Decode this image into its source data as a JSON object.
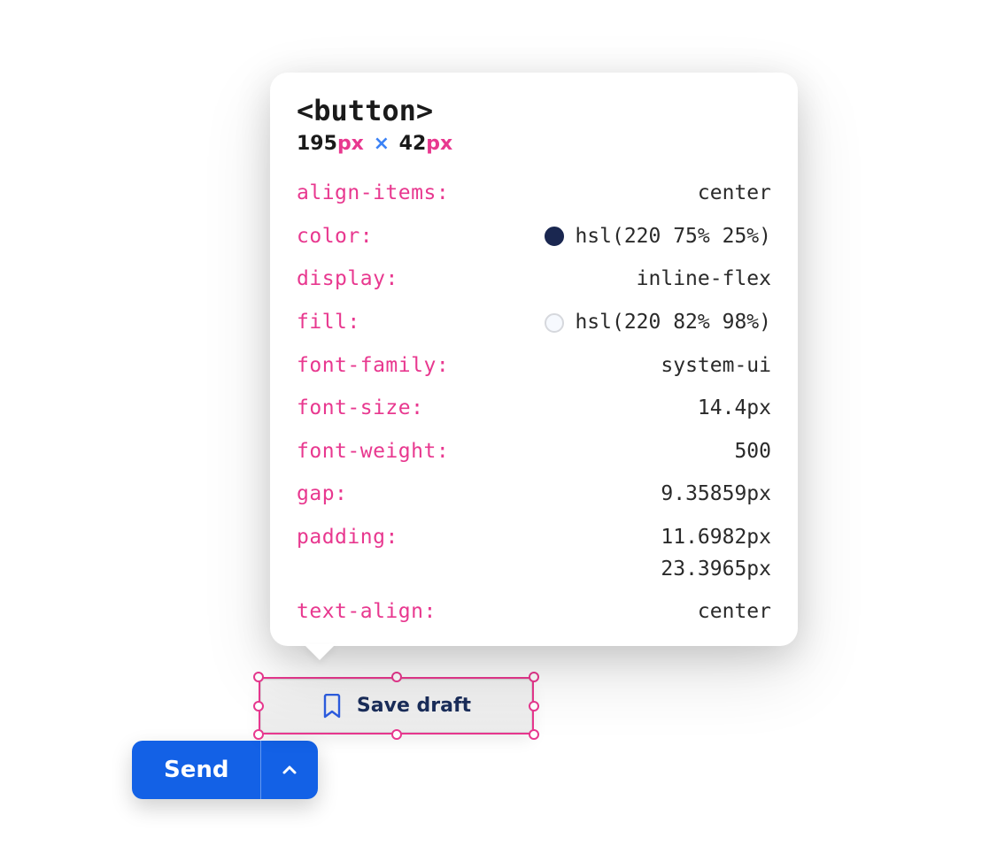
{
  "inspector": {
    "tag": "<button>",
    "dims": {
      "width": "195",
      "width_unit": "px",
      "separator": "×",
      "height": "42",
      "height_unit": "px"
    },
    "props": [
      {
        "name": "align-items",
        "value": "center"
      },
      {
        "name": "color",
        "value": "hsl(220 75% 25%)",
        "swatch": "#122a70"
      },
      {
        "name": "display",
        "value": "inline-flex"
      },
      {
        "name": "fill",
        "value": "hsl(220 82% 98%)",
        "swatch": "#f6f9fe"
      },
      {
        "name": "font-family",
        "value": "system-ui"
      },
      {
        "name": "font-size",
        "value": "14.4px"
      },
      {
        "name": "font-weight",
        "value": "500"
      },
      {
        "name": "gap",
        "value": "9.35859px"
      },
      {
        "name": "padding",
        "value": "11.6982px\n23.3965px"
      },
      {
        "name": "text-align",
        "value": "center"
      }
    ]
  },
  "buttons": {
    "save_draft_label": "Save draft",
    "send_label": "Send"
  },
  "colors": {
    "accent_pink": "#e8388f",
    "accent_blue": "#1361e6",
    "text_dark": "#1a1a1a",
    "button_text": "#1a2d5a"
  }
}
